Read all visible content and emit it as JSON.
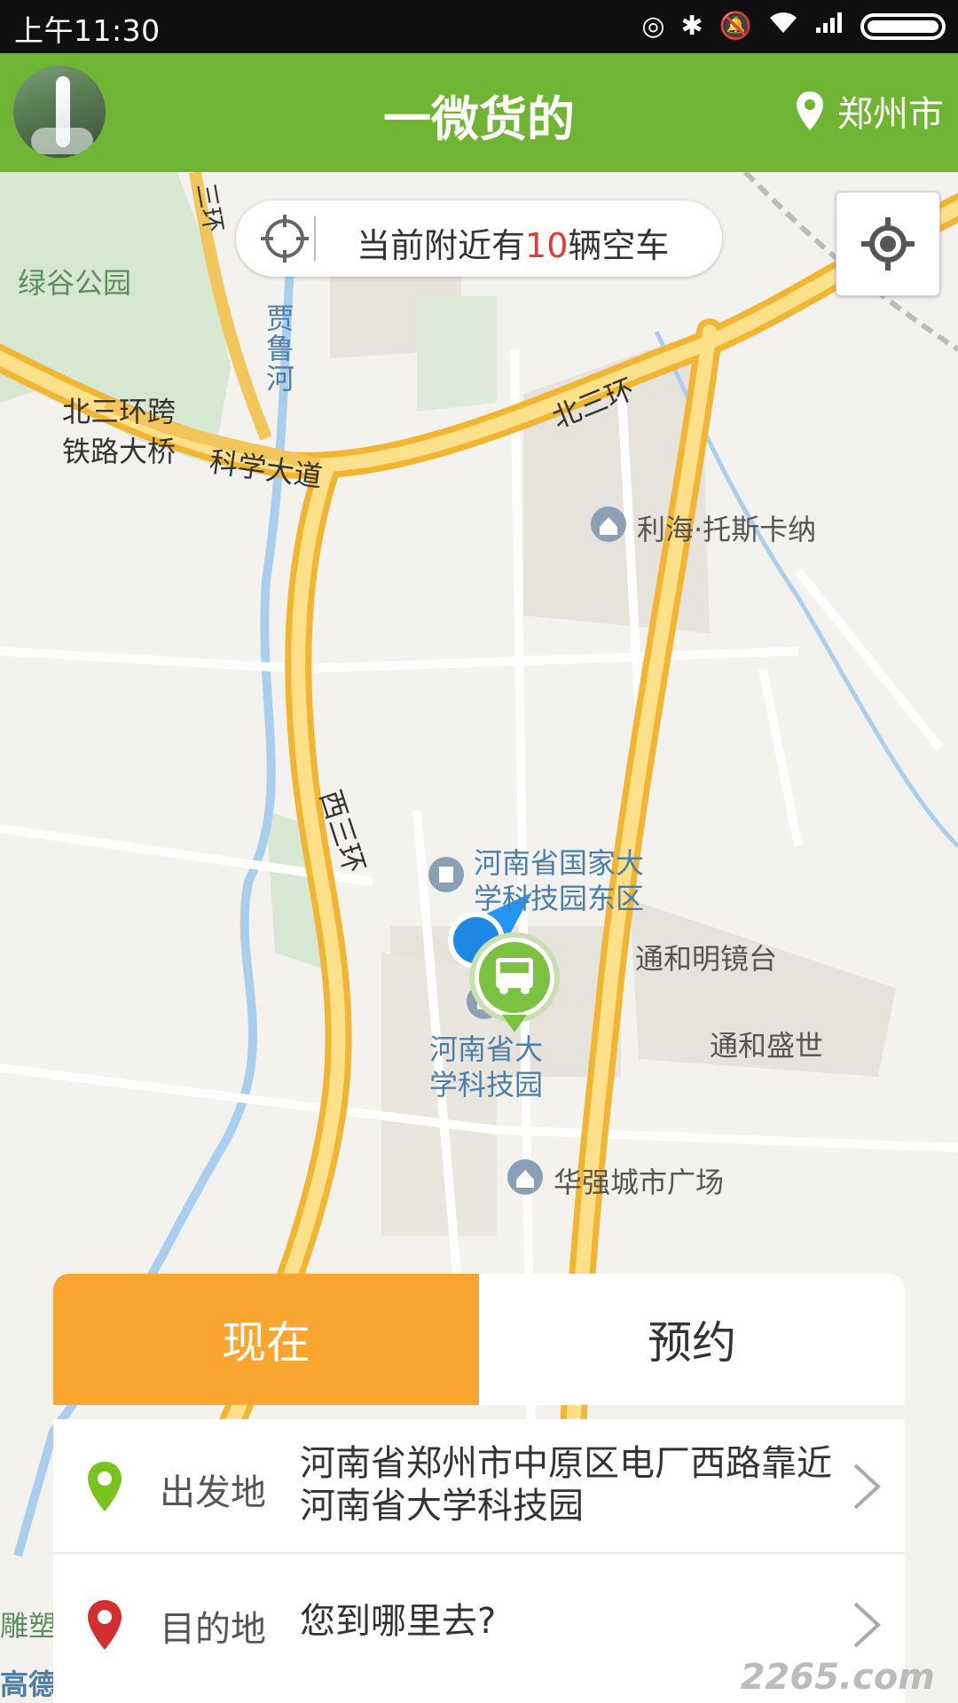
{
  "status_bar": {
    "time": "上午11:30",
    "icons": [
      "hotspot-icon",
      "bluetooth-icon",
      "mute-icon",
      "wifi-icon",
      "signal-icon",
      "battery-icon"
    ]
  },
  "app_bar": {
    "title": "一微货的",
    "city": "郑州市"
  },
  "nearby": {
    "prefix": "当前附近有",
    "count": "10",
    "suffix": "辆空车",
    "count_color": "#e53935"
  },
  "map": {
    "labels": {
      "park": "绿谷公园",
      "river": "贾鲁河",
      "bridge_line1": "北三环跨",
      "bridge_line2": "铁路大桥",
      "road_science": "科学大道",
      "road_north3": "北三环",
      "road_west3": "西三环",
      "ring_fragment": "三环",
      "poi_lihai": "利海·托斯卡纳",
      "poi_park_east_1": "河南省国家大",
      "poi_park_east_2": "学科技园东区",
      "poi_park_1": "河南省大",
      "poi_park_2": "学科技园",
      "poi_tonghe_mirror": "通和明镜台",
      "poi_tonghe_sheng": "通和盛世",
      "poi_huaqiang": "华强城市广场",
      "edge_left_1": "雕塑公",
      "edge_left_2": "高德地图"
    }
  },
  "booking": {
    "tab_now": "现在",
    "tab_reserve": "预约",
    "origin_label": "出发地",
    "origin_value": "河南省郑州市中原区电厂西路靠近河南省大学科技园",
    "destination_label": "目的地",
    "destination_placeholder": "您到哪里去?"
  },
  "watermark": "2265.com",
  "colors": {
    "app_bar": "#6fb432",
    "tab_active": "#fba531",
    "highway": "#f6c443",
    "origin_pin": "#7ac31f",
    "destination_pin": "#d32f2f"
  }
}
